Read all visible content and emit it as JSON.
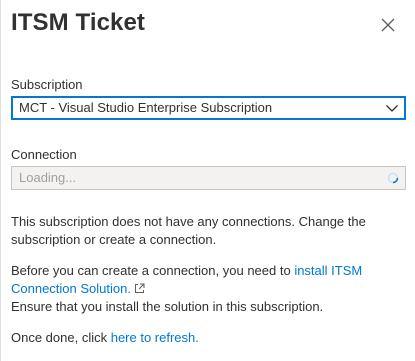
{
  "header": {
    "title": "ITSM Ticket",
    "close_icon": "close-icon"
  },
  "subscription": {
    "label": "Subscription",
    "selected": "MCT - Visual Studio Enterprise Subscription",
    "icon": "chevron-down-icon"
  },
  "connection": {
    "label": "Connection",
    "placeholder": "Loading...",
    "icon": "spinner-icon"
  },
  "messages": {
    "no_connections": "This subscription does not have any connections. Change the subscription or create a connection.",
    "before_text": "Before you can create a connection, you need to ",
    "install_link": "install ITSM Connection Solution.",
    "ensure_text": "Ensure that you install the solution in this subscription.",
    "done_text": "Once done, click ",
    "refresh_link": "here to refresh."
  },
  "colors": {
    "accent": "#0078d4",
    "text": "#323130",
    "disabled_bg": "#f3f2f1"
  }
}
